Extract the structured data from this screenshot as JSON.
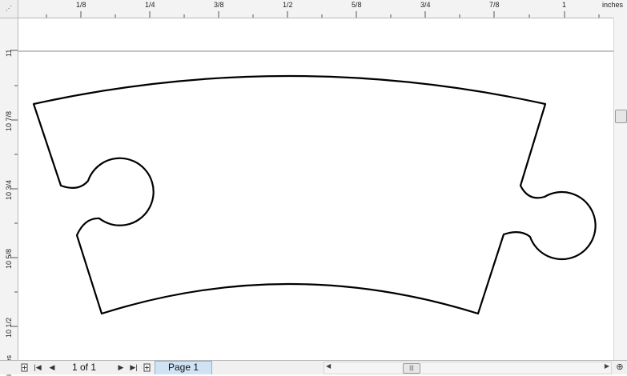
{
  "rulers": {
    "unit_label": "inches",
    "top_ticks": [
      "1/8",
      "1/4",
      "3/8",
      "1/2",
      "5/8",
      "3/4",
      "7/8",
      "1"
    ],
    "left_ticks": [
      "11",
      "10 7/8",
      "10 3/4",
      "10 5/8",
      "10 1/2"
    ]
  },
  "statusbar": {
    "page_count": "1 of 1",
    "page_tab_label": "Page 1"
  },
  "icons": {
    "add_page_left": "add-page-icon",
    "first": "first-page-icon",
    "prev": "prev-page-icon",
    "next": "next-page-icon",
    "last": "last-page-icon",
    "add_page_right": "add-page-icon",
    "zoom": "zoom-icon"
  }
}
